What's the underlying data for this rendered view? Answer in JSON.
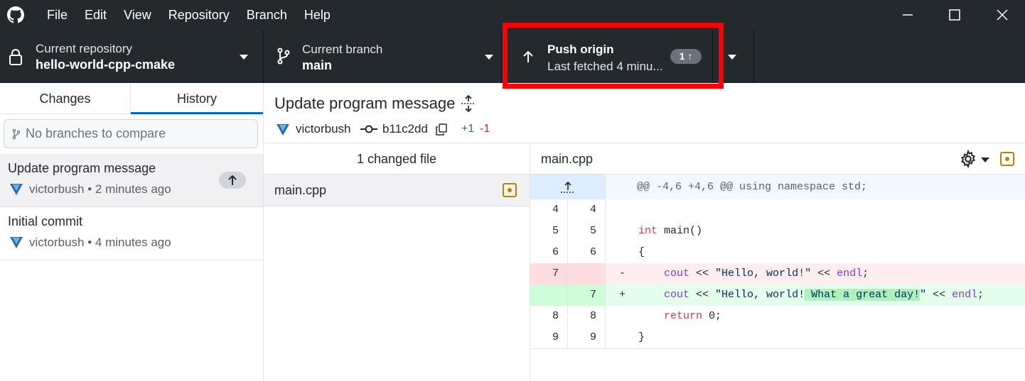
{
  "menu": {
    "items": [
      "File",
      "Edit",
      "View",
      "Repository",
      "Branch",
      "Help"
    ]
  },
  "toolbar": {
    "repo": {
      "label": "Current repository",
      "value": "hello-world-cpp-cmake",
      "icon": "lock-icon"
    },
    "branch": {
      "label": "Current branch",
      "value": "main",
      "icon": "branch-icon"
    },
    "push": {
      "label": "Push origin",
      "sublabel": "Last fetched 4 minu...",
      "count": "1 ↑",
      "icon": "arrow-up-icon"
    }
  },
  "sidebar": {
    "tabs": [
      "Changes",
      "History"
    ],
    "active_tab": "History",
    "compare_placeholder": "No branches to compare",
    "commits": [
      {
        "title": "Update program message",
        "author": "victorbush",
        "time": "• 2 minutes ago",
        "unpushed": true
      },
      {
        "title": "Initial commit",
        "author": "victorbush",
        "time": "• 4 minutes ago",
        "unpushed": false
      }
    ]
  },
  "commit": {
    "title": "Update program message",
    "author": "victorbush",
    "sha": "b11c2dd",
    "additions": "+1",
    "deletions": "-1"
  },
  "files": {
    "header": "1 changed file",
    "items": [
      "main.cpp"
    ]
  },
  "diff": {
    "filename": "main.cpp",
    "hunk": "@@ -4,6 +4,6 @@ using namespace std;",
    "lines": [
      {
        "old": "4",
        "new": "4",
        "type": "context",
        "text": ""
      },
      {
        "old": "5",
        "new": "5",
        "type": "context",
        "text": "int main()"
      },
      {
        "old": "6",
        "new": "6",
        "type": "context",
        "text": "{"
      },
      {
        "old": "7",
        "new": "",
        "type": "del",
        "text": "    cout << \"Hello, world!\" << endl;"
      },
      {
        "old": "",
        "new": "7",
        "type": "add",
        "text": "    cout << \"Hello, world! What a great day!\" << endl;"
      },
      {
        "old": "8",
        "new": "8",
        "type": "context",
        "text": "    return 0;"
      },
      {
        "old": "9",
        "new": "9",
        "type": "context",
        "text": "}"
      }
    ]
  },
  "colors": {
    "titlebar": "#24292e",
    "accent": "#0366d6",
    "highlight": "#ff0000",
    "add_bg": "#e6ffed",
    "del_bg": "#ffeef0",
    "hunk_bg": "#f1f8ff"
  }
}
